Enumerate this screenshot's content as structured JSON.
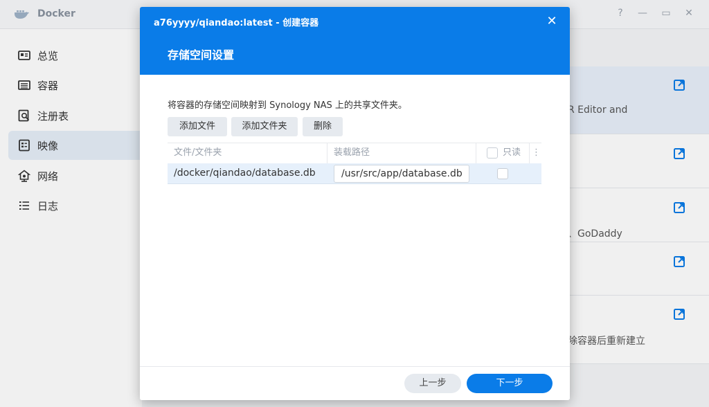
{
  "app": {
    "title": "Docker",
    "window_controls": {
      "help": "?",
      "minimize": "—",
      "maximize": "▭",
      "close": "✕"
    }
  },
  "sidebar": {
    "items": [
      {
        "label": "总览",
        "icon": "overview-icon",
        "active": false
      },
      {
        "label": "容器",
        "icon": "container-icon",
        "active": false
      },
      {
        "label": "注册表",
        "icon": "registry-icon",
        "active": false
      },
      {
        "label": "映像",
        "icon": "image-icon",
        "active": true
      },
      {
        "label": "网络",
        "icon": "network-icon",
        "active": false
      },
      {
        "label": "日志",
        "icon": "log-icon",
        "active": false
      }
    ]
  },
  "background_list": {
    "rows": [
      {
        "text": "R Editor and"
      },
      {
        "text": ""
      },
      {
        "text": "、GoDaddy"
      },
      {
        "text": ""
      },
      {
        "text": "除容器后重新建立"
      }
    ]
  },
  "dialog": {
    "title": "a76yyyy/qiandao:latest - 创建容器",
    "close_label": "✕",
    "heading": "存储空间设置",
    "description": "将容器的存储空间映射到 Synology NAS 上的共享文件夹。",
    "buttons": {
      "add_file": "添加文件",
      "add_folder": "添加文件夹",
      "delete": "删除"
    },
    "table": {
      "columns": {
        "file_folder": "文件/文件夹",
        "mount_path": "装载路径",
        "readonly": "只读",
        "more": "⋮"
      },
      "rows": [
        {
          "file_folder": "/docker/qiandao/database.db",
          "mount_path": "/usr/src/app/database.db",
          "readonly": false
        }
      ]
    },
    "footer": {
      "prev": "上一步",
      "next": "下一步"
    }
  },
  "colors": {
    "accent": "#0a7ce8",
    "row_highlight": "#e6f0fb",
    "sidebar_active": "#e6eef8"
  }
}
